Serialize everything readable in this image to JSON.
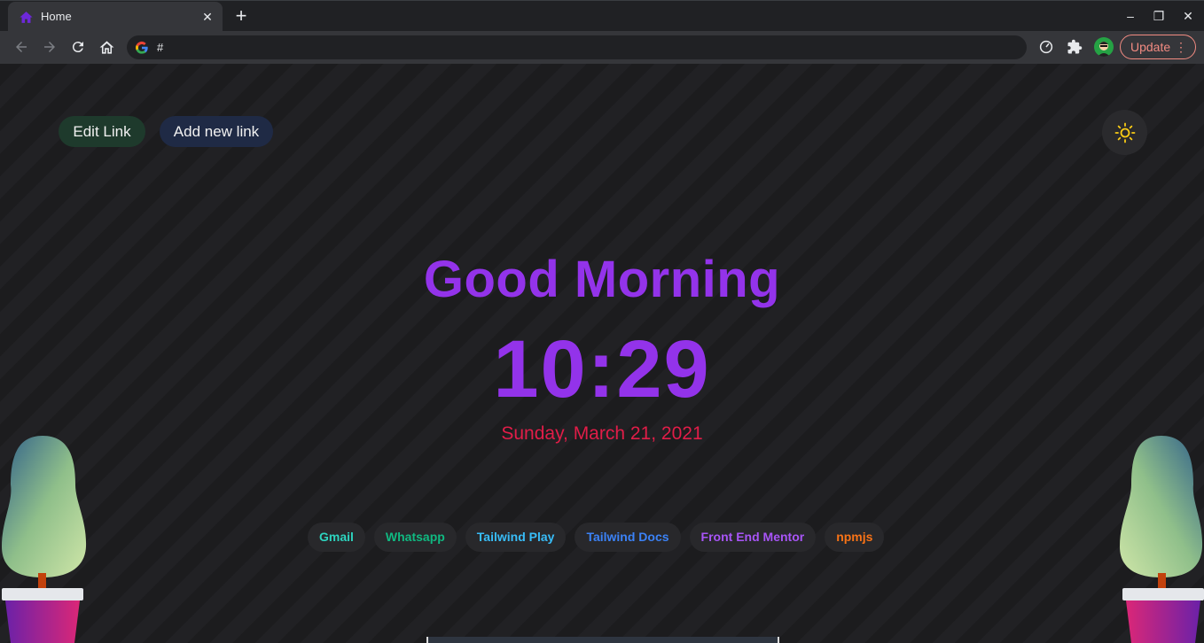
{
  "browser": {
    "tab_title": "Home",
    "tab_close": "✕",
    "new_tab": "+",
    "address": "#",
    "update_label": "Update",
    "update_menu": "⋮",
    "window_controls": {
      "minimize": "–",
      "restore": "❐",
      "close": "✕"
    }
  },
  "header": {
    "edit_link_label": "Edit Link",
    "add_link_label": "Add new link",
    "theme_icon": "sun-icon"
  },
  "main": {
    "greeting": "Good Morning",
    "time": "10:29",
    "date": "Sunday, March 21, 2021"
  },
  "quick_links": [
    {
      "label": "Gmail",
      "color": "#2dd4bf"
    },
    {
      "label": "Whatsapp",
      "color": "#10b981"
    },
    {
      "label": "Tailwind Play",
      "color": "#38bdf8"
    },
    {
      "label": "Tailwind Docs",
      "color": "#3b82f6"
    },
    {
      "label": "Front End Mentor",
      "color": "#a855f7"
    },
    {
      "label": "npmjs",
      "color": "#f97316"
    }
  ],
  "colors": {
    "accent": "#9333ea",
    "date": "#e11d48"
  }
}
